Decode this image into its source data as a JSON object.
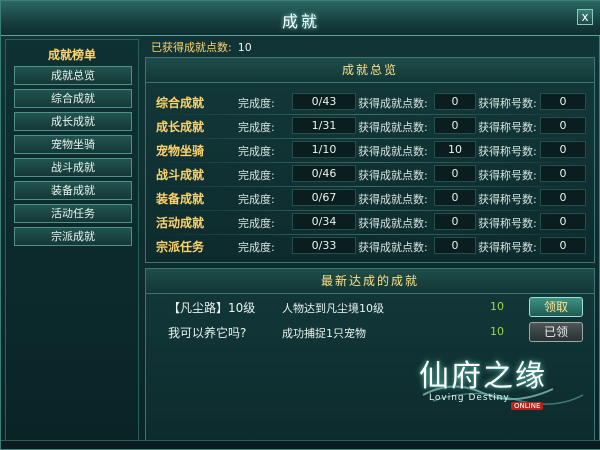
{
  "window": {
    "title": "成就",
    "close_glyph": "x"
  },
  "sidebar": {
    "title": "成就榜单",
    "items": [
      {
        "label": "成就总览"
      },
      {
        "label": "综合成就"
      },
      {
        "label": "成长成就"
      },
      {
        "label": "宠物坐骑"
      },
      {
        "label": "战斗成就"
      },
      {
        "label": "装备成就"
      },
      {
        "label": "活动任务"
      },
      {
        "label": "宗派成就"
      }
    ]
  },
  "summary": {
    "points_label": "已获得成就点数:",
    "points_value": "10"
  },
  "overview": {
    "header": "成就总览",
    "labels": {
      "completion": "完成度:",
      "points": "获得成就点数:",
      "titles": "获得称号数:"
    },
    "rows": [
      {
        "category": "综合成就",
        "completion": "0/43",
        "points": "0",
        "titles": "0"
      },
      {
        "category": "成长成就",
        "completion": "1/31",
        "points": "0",
        "titles": "0"
      },
      {
        "category": "宠物坐骑",
        "completion": "1/10",
        "points": "10",
        "titles": "0"
      },
      {
        "category": "战斗成就",
        "completion": "0/46",
        "points": "0",
        "titles": "0"
      },
      {
        "category": "装备成就",
        "completion": "0/67",
        "points": "0",
        "titles": "0"
      },
      {
        "category": "活动成就",
        "completion": "0/34",
        "points": "0",
        "titles": "0"
      },
      {
        "category": "宗派任务",
        "completion": "0/33",
        "points": "0",
        "titles": "0"
      }
    ]
  },
  "recent": {
    "header": "最新达成的成就",
    "items": [
      {
        "name": "【凡尘路】10级",
        "desc": "人物达到凡尘境10级",
        "points": "10",
        "button": "领取",
        "state": "claim"
      },
      {
        "name": "我可以养它吗?",
        "desc": "成功捕捉1只宠物",
        "points": "10",
        "button": "已领",
        "state": "claimed"
      }
    ]
  },
  "logo": {
    "text": "仙府之缘",
    "subtitle": "Loving Destiny",
    "tag": "ONLINE"
  },
  "colors": {
    "accent_gold": "#ffd36b",
    "points_green": "#9bd84a",
    "panel_border": "#3b7770"
  }
}
